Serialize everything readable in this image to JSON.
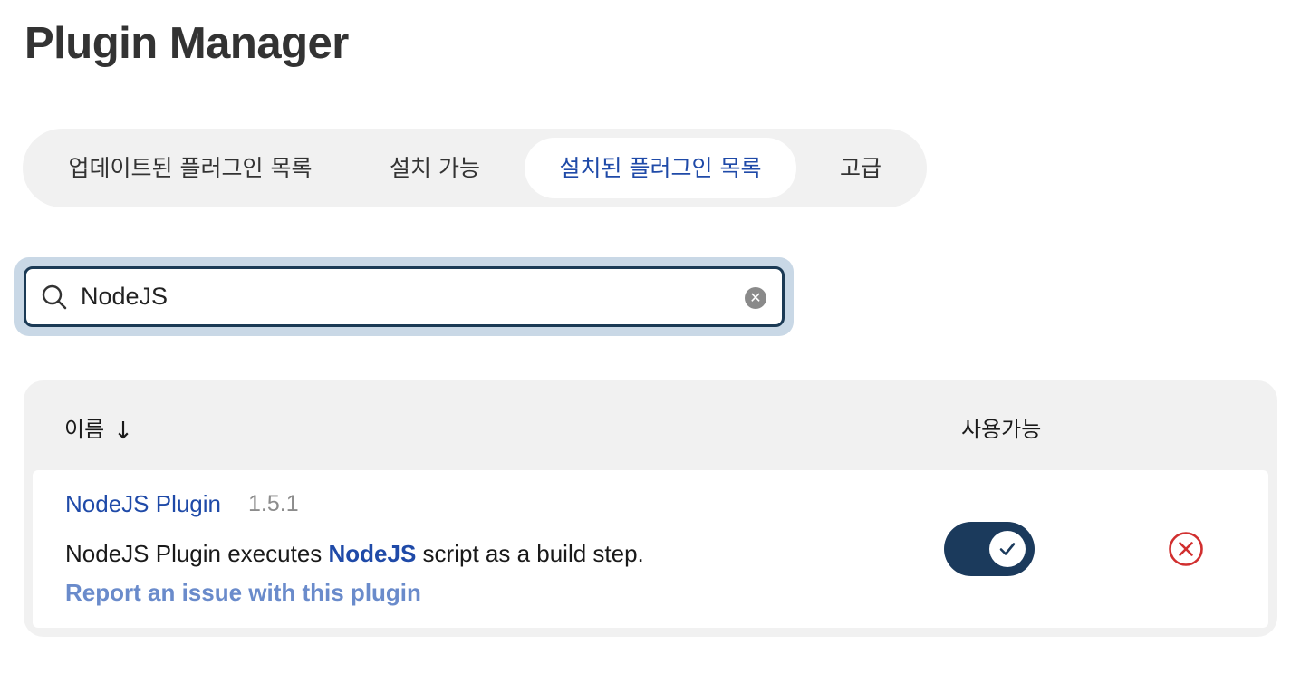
{
  "page": {
    "title": "Plugin Manager"
  },
  "tabs": [
    {
      "label": "업데이트된 플러그인 목록",
      "active": false
    },
    {
      "label": "설치 가능",
      "active": false
    },
    {
      "label": "설치된 플러그인 목록",
      "active": true
    },
    {
      "label": "고급",
      "active": false
    }
  ],
  "search": {
    "value": "NodeJS",
    "placeholder": "",
    "icon": "search-icon",
    "clear_icon": "clear-icon"
  },
  "table": {
    "headers": {
      "name": "이름",
      "sort_indicator": "↓",
      "enabled": "사용가능"
    },
    "rows": [
      {
        "name": "NodeJS Plugin",
        "version": "1.5.1",
        "description_pre": "NodeJS Plugin executes ",
        "description_link": "NodeJS",
        "description_post": " script as a build step.",
        "report_link": "Report an issue with this plugin",
        "enabled": true
      }
    ]
  },
  "colors": {
    "accent": "#1f4aa8",
    "toggle_on": "#1b3a5c",
    "uninstall": "#d12f2f",
    "link_muted": "#6a8bcb"
  }
}
